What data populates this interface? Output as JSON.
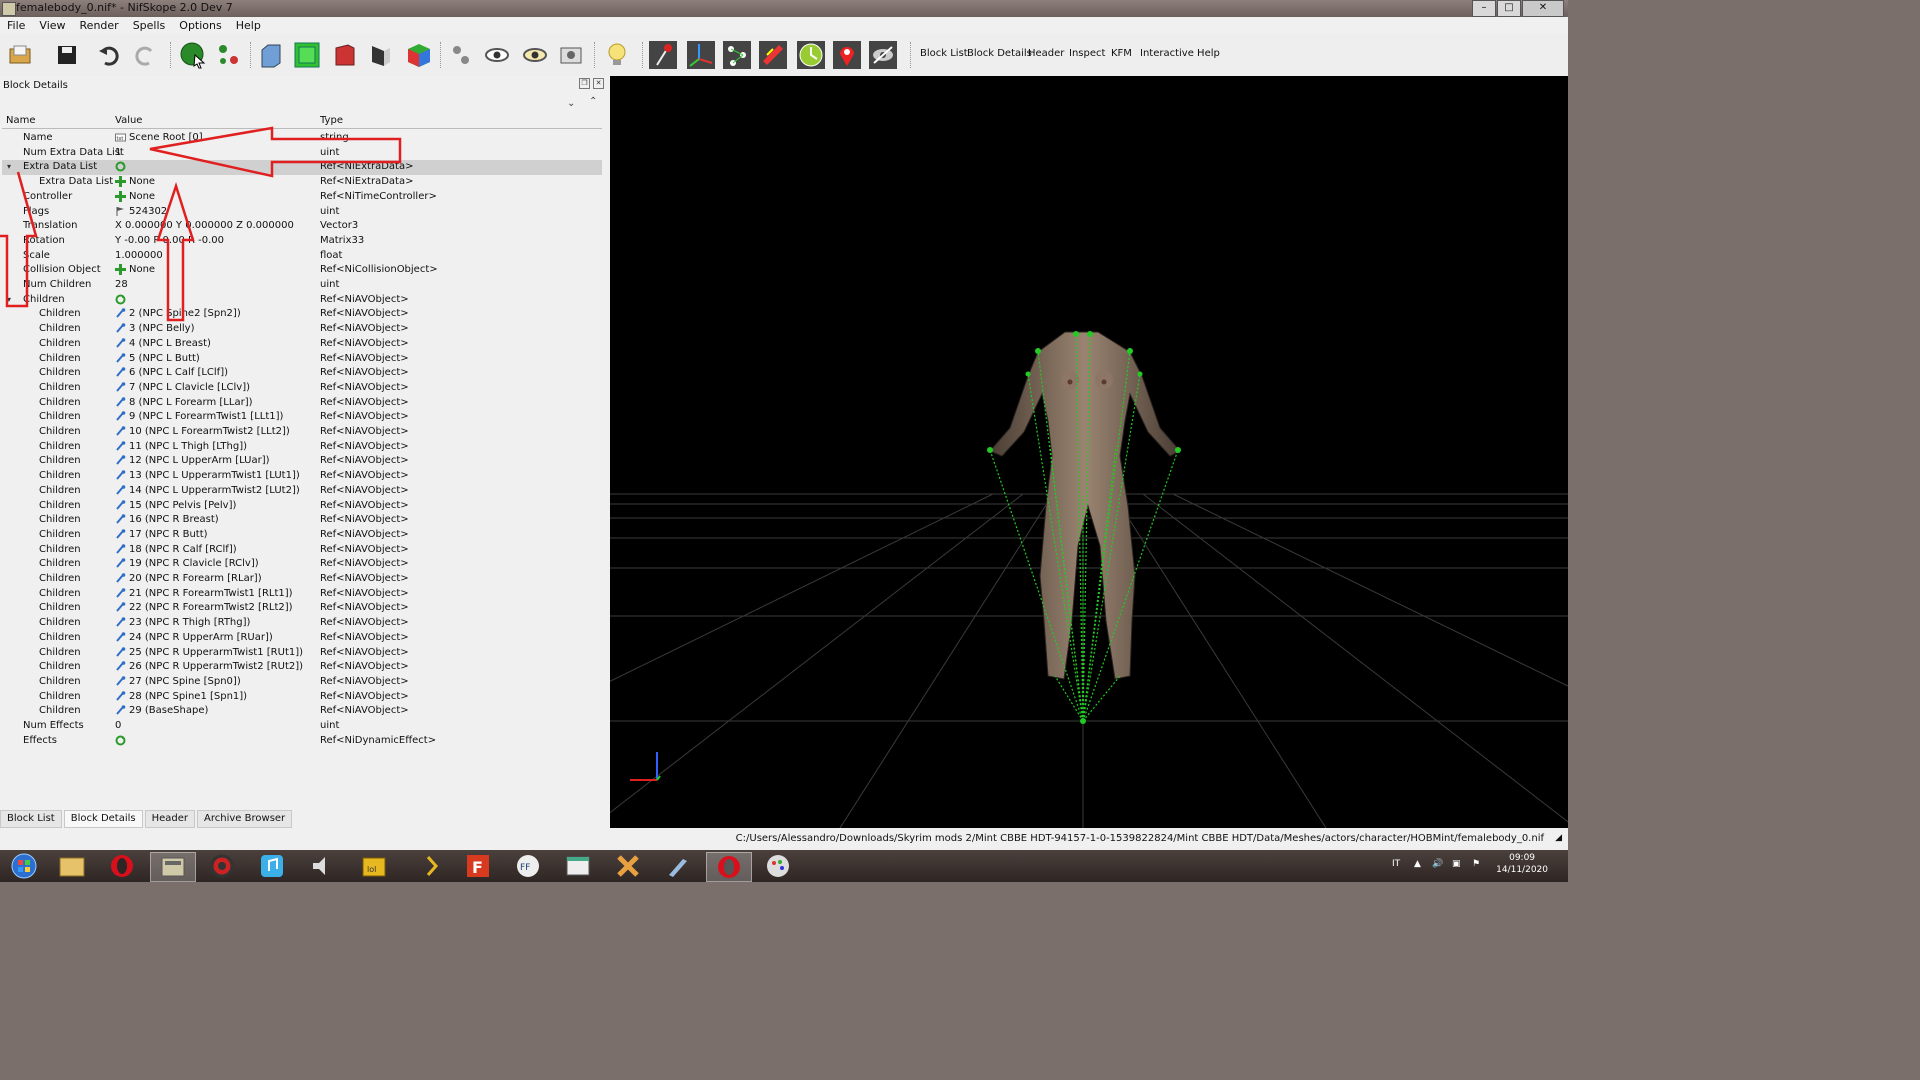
{
  "window": {
    "title": "femalebody_0.nif* - NifSkope 2.0 Dev 7"
  },
  "menu": [
    "File",
    "View",
    "Render",
    "Spells",
    "Options",
    "Help"
  ],
  "toolbar": {
    "text_buttons": [
      "Block List",
      "Block Details",
      "Header",
      "Inspect",
      "KFM",
      "Interactive Help"
    ]
  },
  "panel": {
    "title": "Block Details",
    "columns": {
      "name": "Name",
      "value": "Value",
      "type": "Type"
    },
    "rows": [
      {
        "name": "Name",
        "value": "Scene Root [0]",
        "type": "string",
        "indent": 0,
        "icon": "text-icon"
      },
      {
        "name": "Num Extra Data List",
        "value": "1",
        "type": "uint",
        "indent": 0,
        "icon": ""
      },
      {
        "name": "Extra Data List",
        "value": "",
        "type": "Ref<NiExtraData>",
        "indent": 0,
        "icon": "refresh-icon",
        "selected": true,
        "expander": "expanded"
      },
      {
        "name": "Extra Data List",
        "value": "None",
        "type": "Ref<NiExtraData>",
        "indent": 1,
        "icon": "plus-icon"
      },
      {
        "name": "Controller",
        "value": "None",
        "type": "Ref<NiTimeController>",
        "indent": 0,
        "icon": "plus-icon"
      },
      {
        "name": "Flags",
        "value": "524302",
        "type": "uint",
        "indent": 0,
        "icon": "flag-icon"
      },
      {
        "name": "Translation",
        "value": "X 0.000000 Y 0.000000 Z 0.000000",
        "type": "Vector3",
        "indent": 0,
        "icon": ""
      },
      {
        "name": "Rotation",
        "value": "Y -0.00 P 0.00 R -0.00",
        "type": "Matrix33",
        "indent": 0,
        "icon": ""
      },
      {
        "name": "Scale",
        "value": "1.000000",
        "type": "float",
        "indent": 0,
        "icon": ""
      },
      {
        "name": "Collision Object",
        "value": "None",
        "type": "Ref<NiCollisionObject>",
        "indent": 0,
        "icon": "plus-icon"
      },
      {
        "name": "Num Children",
        "value": "28",
        "type": "uint",
        "indent": 0,
        "icon": ""
      },
      {
        "name": "Children",
        "value": "",
        "type": "Ref<NiAVObject>",
        "indent": 0,
        "icon": "refresh-icon",
        "expander": "expanded"
      },
      {
        "name": "Children",
        "value": "2 (NPC Spine2 [Spn2])",
        "type": "Ref<NiAVObject>",
        "indent": 1,
        "icon": "link-icon"
      },
      {
        "name": "Children",
        "value": "3 (NPC Belly)",
        "type": "Ref<NiAVObject>",
        "indent": 1,
        "icon": "link-icon"
      },
      {
        "name": "Children",
        "value": "4 (NPC L Breast)",
        "type": "Ref<NiAVObject>",
        "indent": 1,
        "icon": "link-icon"
      },
      {
        "name": "Children",
        "value": "5 (NPC L Butt)",
        "type": "Ref<NiAVObject>",
        "indent": 1,
        "icon": "link-icon"
      },
      {
        "name": "Children",
        "value": "6 (NPC L Calf [LClf])",
        "type": "Ref<NiAVObject>",
        "indent": 1,
        "icon": "link-icon"
      },
      {
        "name": "Children",
        "value": "7 (NPC L Clavicle [LClv])",
        "type": "Ref<NiAVObject>",
        "indent": 1,
        "icon": "link-icon"
      },
      {
        "name": "Children",
        "value": "8 (NPC L Forearm [LLar])",
        "type": "Ref<NiAVObject>",
        "indent": 1,
        "icon": "link-icon"
      },
      {
        "name": "Children",
        "value": "9 (NPC L ForearmTwist1 [LLt1])",
        "type": "Ref<NiAVObject>",
        "indent": 1,
        "icon": "link-icon"
      },
      {
        "name": "Children",
        "value": "10 (NPC L ForearmTwist2 [LLt2])",
        "type": "Ref<NiAVObject>",
        "indent": 1,
        "icon": "link-icon"
      },
      {
        "name": "Children",
        "value": "11 (NPC L Thigh [LThg])",
        "type": "Ref<NiAVObject>",
        "indent": 1,
        "icon": "link-icon"
      },
      {
        "name": "Children",
        "value": "12 (NPC L UpperArm [LUar])",
        "type": "Ref<NiAVObject>",
        "indent": 1,
        "icon": "link-icon"
      },
      {
        "name": "Children",
        "value": "13 (NPC L UpperarmTwist1 [LUt1])",
        "type": "Ref<NiAVObject>",
        "indent": 1,
        "icon": "link-icon"
      },
      {
        "name": "Children",
        "value": "14 (NPC L UpperarmTwist2 [LUt2])",
        "type": "Ref<NiAVObject>",
        "indent": 1,
        "icon": "link-icon"
      },
      {
        "name": "Children",
        "value": "15 (NPC Pelvis [Pelv])",
        "type": "Ref<NiAVObject>",
        "indent": 1,
        "icon": "link-icon"
      },
      {
        "name": "Children",
        "value": "16 (NPC R Breast)",
        "type": "Ref<NiAVObject>",
        "indent": 1,
        "icon": "link-icon"
      },
      {
        "name": "Children",
        "value": "17 (NPC R Butt)",
        "type": "Ref<NiAVObject>",
        "indent": 1,
        "icon": "link-icon"
      },
      {
        "name": "Children",
        "value": "18 (NPC R Calf [RClf])",
        "type": "Ref<NiAVObject>",
        "indent": 1,
        "icon": "link-icon"
      },
      {
        "name": "Children",
        "value": "19 (NPC R Clavicle [RClv])",
        "type": "Ref<NiAVObject>",
        "indent": 1,
        "icon": "link-icon"
      },
      {
        "name": "Children",
        "value": "20 (NPC R Forearm [RLar])",
        "type": "Ref<NiAVObject>",
        "indent": 1,
        "icon": "link-icon"
      },
      {
        "name": "Children",
        "value": "21 (NPC R ForearmTwist1 [RLt1])",
        "type": "Ref<NiAVObject>",
        "indent": 1,
        "icon": "link-icon"
      },
      {
        "name": "Children",
        "value": "22 (NPC R ForearmTwist2 [RLt2])",
        "type": "Ref<NiAVObject>",
        "indent": 1,
        "icon": "link-icon"
      },
      {
        "name": "Children",
        "value": "23 (NPC R Thigh [RThg])",
        "type": "Ref<NiAVObject>",
        "indent": 1,
        "icon": "link-icon"
      },
      {
        "name": "Children",
        "value": "24 (NPC R UpperArm [RUar])",
        "type": "Ref<NiAVObject>",
        "indent": 1,
        "icon": "link-icon"
      },
      {
        "name": "Children",
        "value": "25 (NPC R UpperarmTwist1 [RUt1])",
        "type": "Ref<NiAVObject>",
        "indent": 1,
        "icon": "link-icon"
      },
      {
        "name": "Children",
        "value": "26 (NPC R UpperarmTwist2 [RUt2])",
        "type": "Ref<NiAVObject>",
        "indent": 1,
        "icon": "link-icon"
      },
      {
        "name": "Children",
        "value": "27 (NPC Spine [Spn0])",
        "type": "Ref<NiAVObject>",
        "indent": 1,
        "icon": "link-icon"
      },
      {
        "name": "Children",
        "value": "28 (NPC Spine1 [Spn1])",
        "type": "Ref<NiAVObject>",
        "indent": 1,
        "icon": "link-icon"
      },
      {
        "name": "Children",
        "value": "29 (BaseShape)",
        "type": "Ref<NiAVObject>",
        "indent": 1,
        "icon": "link-icon"
      },
      {
        "name": "Num Effects",
        "value": "0",
        "type": "uint",
        "indent": 0,
        "icon": ""
      },
      {
        "name": "Effects",
        "value": "",
        "type": "Ref<NiDynamicEffect>",
        "indent": 0,
        "icon": "refresh-icon"
      }
    ],
    "bottom_tabs": [
      "Block List",
      "Block Details",
      "Header",
      "Archive Browser"
    ],
    "active_bottom_tab": "Block Details"
  },
  "status": {
    "path": "C:/Users/Alessandro/Downloads/Skyrim mods 2/Mint CBBE HDT-94157-1-0-1539822824/Mint CBBE HDT/Data/Meshes/actors/character/HOBMint/femalebody_0.nif"
  },
  "taskbar": {
    "language": "IT",
    "time": "09:09",
    "date": "14/11/2020"
  },
  "colors": {
    "annotation_arrow": "#e02020",
    "skeleton": "#22cc22",
    "accent": "#2a8a2a"
  }
}
